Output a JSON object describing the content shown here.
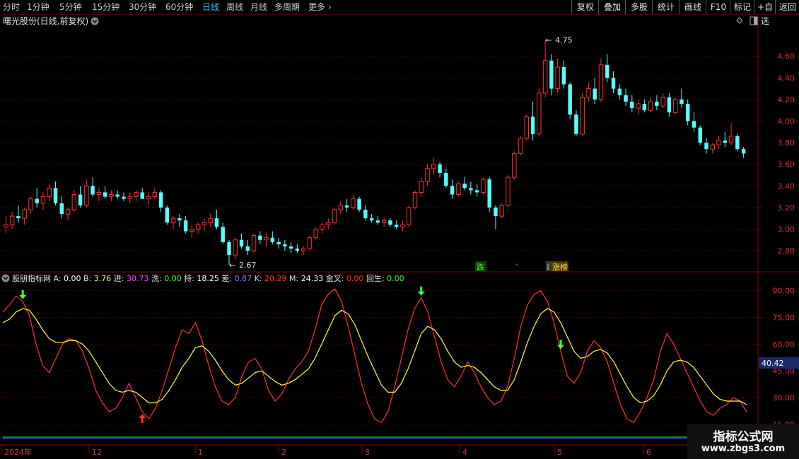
{
  "toolbar": {
    "periods": [
      "分时",
      "1分钟",
      "5分钟",
      "15分钟",
      "30分钟",
      "60分钟",
      "日线",
      "周线",
      "月线",
      "多周期",
      "更多"
    ],
    "active_period": "日线",
    "more_chevron_icon": "chevron-right-icon",
    "right_buttons": [
      "复权",
      "叠加",
      "多股",
      "统计",
      "画线",
      "F10",
      "标记",
      "+自选",
      "返回"
    ]
  },
  "main_panel": {
    "title": "曙光股份(日线,前复权)",
    "title_dropdown_icon": "chevron-down-icon",
    "corner_icons": [
      "diamond-icon",
      "panel-toggle-icon"
    ],
    "price_axis": [
      "4.60",
      "4.40",
      "4.20",
      "4.00",
      "3.80",
      "3.60",
      "3.40",
      "3.20",
      "3.00",
      "2.80"
    ],
    "high_label": "4.75",
    "low_label": "2.67",
    "tags": {
      "die": "跌",
      "zhangbang": "涨榜"
    }
  },
  "indicator": {
    "name": "股朋指标网",
    "fields": [
      {
        "label": "A:",
        "value": "0.00",
        "color": "#ffffff"
      },
      {
        "label": "B:",
        "value": "3.76",
        "color": "#ffff40"
      },
      {
        "label": "进:",
        "value": "30.73",
        "color": "#ff40ff"
      },
      {
        "label": "洗:",
        "value": "0.00",
        "color": "#40ff40"
      },
      {
        "label": "持:",
        "value": "18.25",
        "color": "#ffffff"
      },
      {
        "label": "差:",
        "value": "0.87",
        "color": "#8080ff"
      },
      {
        "label": "K:",
        "value": "20.29",
        "color": "#ff3030"
      },
      {
        "label": "M:",
        "value": "24.33",
        "color": "#ffffff"
      },
      {
        "label": "金叉:",
        "value": "0.00",
        "color": "#ff3030"
      },
      {
        "label": "回生:",
        "value": "0.00",
        "color": "#40ff40"
      }
    ],
    "axis": [
      "90.00",
      "75.00",
      "60.00",
      "45.00",
      "30.00",
      "15.00"
    ],
    "current_value": "40.42"
  },
  "time_axis": {
    "labels": [
      "2024年",
      "12",
      "1",
      "2",
      "3",
      "4",
      "5",
      "6"
    ]
  },
  "watermark": {
    "line1": "指标公式网",
    "line2": "www.zbgs3.com"
  },
  "chart_data": [
    {
      "type": "candlestick",
      "title": "曙光股份(日线,前复权)",
      "y_ticks": [
        4.6,
        4.4,
        4.2,
        4.0,
        3.8,
        3.6,
        3.4,
        3.2,
        3.0,
        2.8
      ],
      "ylim": [
        2.65,
        4.82
      ],
      "x_ticks": [
        "2024年",
        "12",
        "1",
        "2",
        "3",
        "4",
        "5",
        "6"
      ],
      "annotations": [
        {
          "text": "4.75",
          "value": 4.75
        },
        {
          "text": "2.67",
          "value": 2.67
        }
      ],
      "up_color": "#ff3030",
      "down_color": "#54ffff",
      "ohlc": [
        [
          3.02,
          3.12,
          2.96,
          3.04
        ],
        [
          3.04,
          3.16,
          3.0,
          3.12
        ],
        [
          3.12,
          3.22,
          3.06,
          3.1
        ],
        [
          3.1,
          3.2,
          3.04,
          3.18
        ],
        [
          3.18,
          3.3,
          3.14,
          3.28
        ],
        [
          3.28,
          3.38,
          3.2,
          3.24
        ],
        [
          3.24,
          3.34,
          3.18,
          3.3
        ],
        [
          3.3,
          3.42,
          3.26,
          3.38
        ],
        [
          3.38,
          3.44,
          3.22,
          3.24
        ],
        [
          3.24,
          3.3,
          3.1,
          3.14
        ],
        [
          3.14,
          3.2,
          3.08,
          3.18
        ],
        [
          3.18,
          3.36,
          3.16,
          3.32
        ],
        [
          3.32,
          3.4,
          3.2,
          3.22
        ],
        [
          3.22,
          3.46,
          3.2,
          3.4
        ],
        [
          3.4,
          3.48,
          3.3,
          3.32
        ],
        [
          3.32,
          3.38,
          3.26,
          3.34
        ],
        [
          3.34,
          3.4,
          3.28,
          3.3
        ],
        [
          3.3,
          3.36,
          3.26,
          3.32
        ],
        [
          3.32,
          3.36,
          3.28,
          3.3
        ],
        [
          3.3,
          3.34,
          3.26,
          3.28
        ],
        [
          3.28,
          3.34,
          3.24,
          3.3
        ],
        [
          3.3,
          3.36,
          3.26,
          3.34
        ],
        [
          3.34,
          3.38,
          3.3,
          3.28
        ],
        [
          3.28,
          3.34,
          3.22,
          3.3
        ],
        [
          3.3,
          3.38,
          3.28,
          3.34
        ],
        [
          3.34,
          3.36,
          3.16,
          3.2
        ],
        [
          3.2,
          3.22,
          3.04,
          3.06
        ],
        [
          3.06,
          3.12,
          3.0,
          3.1
        ],
        [
          3.1,
          3.14,
          3.02,
          3.08
        ],
        [
          3.08,
          3.12,
          2.96,
          2.98
        ],
        [
          2.98,
          3.04,
          2.92,
          3.0
        ],
        [
          3.0,
          3.06,
          2.96,
          3.04
        ],
        [
          3.04,
          3.1,
          2.98,
          3.06
        ],
        [
          3.06,
          3.14,
          3.02,
          3.1
        ],
        [
          3.1,
          3.18,
          3.0,
          3.02
        ],
        [
          3.02,
          3.06,
          2.86,
          2.88
        ],
        [
          2.88,
          2.9,
          2.67,
          2.76
        ],
        [
          2.76,
          2.92,
          2.72,
          2.9
        ],
        [
          2.9,
          2.96,
          2.82,
          2.84
        ],
        [
          2.84,
          2.9,
          2.76,
          2.8
        ],
        [
          2.8,
          2.96,
          2.78,
          2.94
        ],
        [
          2.94,
          2.98,
          2.86,
          2.9
        ],
        [
          2.9,
          2.96,
          2.84,
          2.92
        ],
        [
          2.92,
          2.98,
          2.86,
          2.88
        ],
        [
          2.88,
          2.92,
          2.82,
          2.86
        ],
        [
          2.86,
          2.9,
          2.8,
          2.84
        ],
        [
          2.84,
          2.88,
          2.78,
          2.82
        ],
        [
          2.82,
          2.86,
          2.78,
          2.8
        ],
        [
          2.8,
          2.84,
          2.76,
          2.82
        ],
        [
          2.82,
          2.94,
          2.8,
          2.92
        ],
        [
          2.92,
          3.02,
          2.9,
          3.0
        ],
        [
          3.0,
          3.06,
          2.96,
          3.04
        ],
        [
          3.04,
          3.1,
          3.0,
          3.06
        ],
        [
          3.06,
          3.2,
          3.04,
          3.18
        ],
        [
          3.18,
          3.26,
          3.14,
          3.22
        ],
        [
          3.22,
          3.28,
          3.16,
          3.2
        ],
        [
          3.2,
          3.32,
          3.18,
          3.28
        ],
        [
          3.28,
          3.3,
          3.16,
          3.18
        ],
        [
          3.18,
          3.22,
          3.08,
          3.1
        ],
        [
          3.1,
          3.14,
          3.06,
          3.08
        ],
        [
          3.08,
          3.12,
          3.04,
          3.06
        ],
        [
          3.06,
          3.1,
          3.02,
          3.08
        ],
        [
          3.08,
          3.1,
          3.02,
          3.04
        ],
        [
          3.04,
          3.08,
          3.0,
          3.02
        ],
        [
          3.02,
          3.08,
          2.98,
          3.04
        ],
        [
          3.04,
          3.22,
          3.02,
          3.2
        ],
        [
          3.2,
          3.36,
          3.18,
          3.34
        ],
        [
          3.34,
          3.48,
          3.3,
          3.44
        ],
        [
          3.44,
          3.6,
          3.4,
          3.56
        ],
        [
          3.56,
          3.66,
          3.5,
          3.6
        ],
        [
          3.6,
          3.62,
          3.48,
          3.52
        ],
        [
          3.52,
          3.56,
          3.38,
          3.4
        ],
        [
          3.4,
          3.46,
          3.28,
          3.32
        ],
        [
          3.32,
          3.44,
          3.3,
          3.42
        ],
        [
          3.42,
          3.48,
          3.36,
          3.38
        ],
        [
          3.38,
          3.44,
          3.32,
          3.36
        ],
        [
          3.36,
          3.42,
          3.3,
          3.34
        ],
        [
          3.34,
          3.48,
          3.32,
          3.46
        ],
        [
          3.46,
          3.48,
          3.16,
          3.2
        ],
        [
          3.2,
          3.22,
          3.0,
          3.12
        ],
        [
          3.12,
          3.24,
          3.1,
          3.22
        ],
        [
          3.22,
          3.5,
          3.2,
          3.48
        ],
        [
          3.48,
          3.72,
          3.46,
          3.7
        ],
        [
          3.7,
          3.86,
          3.68,
          3.84
        ],
        [
          3.84,
          4.06,
          3.82,
          4.04
        ],
        [
          4.04,
          4.18,
          3.82,
          3.88
        ],
        [
          3.88,
          4.3,
          3.86,
          4.26
        ],
        [
          4.26,
          4.75,
          4.22,
          4.56
        ],
        [
          4.56,
          4.62,
          4.24,
          4.3
        ],
        [
          4.3,
          4.58,
          4.26,
          4.5
        ],
        [
          4.5,
          4.56,
          4.3,
          4.34
        ],
        [
          4.34,
          4.36,
          4.02,
          4.06
        ],
        [
          4.06,
          4.1,
          3.86,
          3.88
        ],
        [
          3.88,
          4.26,
          3.86,
          4.22
        ],
        [
          4.22,
          4.36,
          4.18,
          4.3
        ],
        [
          4.3,
          4.4,
          4.16,
          4.2
        ],
        [
          4.2,
          4.58,
          4.18,
          4.52
        ],
        [
          4.52,
          4.62,
          4.36,
          4.4
        ],
        [
          4.4,
          4.46,
          4.26,
          4.3
        ],
        [
          4.3,
          4.34,
          4.2,
          4.24
        ],
        [
          4.24,
          4.3,
          4.14,
          4.18
        ],
        [
          4.18,
          4.24,
          4.08,
          4.12
        ],
        [
          4.12,
          4.2,
          4.06,
          4.16
        ],
        [
          4.16,
          4.2,
          4.08,
          4.1
        ],
        [
          4.1,
          4.22,
          4.08,
          4.18
        ],
        [
          4.18,
          4.24,
          4.1,
          4.14
        ],
        [
          4.14,
          4.26,
          4.12,
          4.22
        ],
        [
          4.22,
          4.26,
          4.04,
          4.08
        ],
        [
          4.08,
          4.22,
          4.06,
          4.2
        ],
        [
          4.2,
          4.3,
          4.12,
          4.16
        ],
        [
          4.16,
          4.2,
          3.96,
          4.0
        ],
        [
          4.0,
          4.08,
          3.9,
          3.94
        ],
        [
          3.94,
          3.96,
          3.78,
          3.8
        ],
        [
          3.8,
          3.84,
          3.7,
          3.74
        ],
        [
          3.74,
          3.8,
          3.7,
          3.78
        ],
        [
          3.78,
          3.86,
          3.74,
          3.82
        ],
        [
          3.82,
          3.9,
          3.76,
          3.8
        ],
        [
          3.8,
          3.98,
          3.78,
          3.86
        ],
        [
          3.86,
          3.88,
          3.72,
          3.74
        ],
        [
          3.74,
          3.76,
          3.66,
          3.7
        ]
      ]
    },
    {
      "type": "line",
      "title": "股朋指标网",
      "y_ticks": [
        90,
        75,
        60,
        45,
        30,
        15
      ],
      "ylim": [
        5,
        97
      ],
      "series": [
        {
          "name": "K",
          "color": "#ff3030",
          "values": [
            78,
            82,
            87,
            84,
            76,
            60,
            48,
            44,
            52,
            60,
            63,
            62,
            56,
            46,
            34,
            27,
            22,
            24,
            30,
            38,
            30,
            22,
            18,
            24,
            34,
            46,
            58,
            68,
            66,
            72,
            62,
            48,
            36,
            28,
            26,
            30,
            42,
            50,
            52,
            46,
            34,
            28,
            32,
            40,
            46,
            50,
            56,
            68,
            82,
            88,
            91,
            84,
            70,
            54,
            38,
            26,
            18,
            16,
            22,
            36,
            52,
            68,
            80,
            86,
            78,
            64,
            50,
            40,
            36,
            42,
            50,
            44,
            36,
            30,
            26,
            28,
            36,
            52,
            70,
            82,
            88,
            90,
            84,
            72,
            56,
            42,
            38,
            44,
            56,
            62,
            58,
            50,
            38,
            26,
            18,
            16,
            22,
            30,
            40,
            56,
            66,
            60,
            52,
            44,
            36,
            28,
            22,
            20,
            24,
            26,
            30,
            28,
            22
          ]
        },
        {
          "name": "M",
          "color": "#ffff40",
          "values": [
            72,
            74,
            78,
            80,
            79,
            74,
            68,
            63,
            61,
            61,
            62,
            62,
            60,
            56,
            50,
            44,
            38,
            34,
            33,
            34,
            33,
            30,
            27,
            27,
            29,
            34,
            40,
            47,
            52,
            58,
            59,
            56,
            51,
            45,
            40,
            37,
            38,
            41,
            44,
            45,
            42,
            39,
            37,
            38,
            40,
            43,
            46,
            52,
            60,
            68,
            76,
            79,
            77,
            71,
            62,
            53,
            45,
            37,
            33,
            33,
            38,
            46,
            56,
            66,
            70,
            68,
            63,
            56,
            50,
            47,
            48,
            47,
            44,
            40,
            36,
            34,
            34,
            40,
            50,
            61,
            70,
            77,
            80,
            78,
            72,
            64,
            56,
            52,
            53,
            56,
            57,
            55,
            50,
            43,
            36,
            30,
            27,
            28,
            31,
            37,
            45,
            50,
            51,
            50,
            47,
            42,
            37,
            32,
            29,
            28,
            28,
            28,
            26
          ]
        }
      ],
      "markers": [
        {
          "type": "down_arrow",
          "color": "#40ff40",
          "index": 3
        },
        {
          "type": "down_arrow",
          "color": "#40ff40",
          "index": 63
        },
        {
          "type": "down_arrow",
          "color": "#40ff40",
          "index": 84
        },
        {
          "type": "up_arrow",
          "color": "#ff3030",
          "index": 21
        }
      ],
      "current_value": 40.42
    }
  ]
}
